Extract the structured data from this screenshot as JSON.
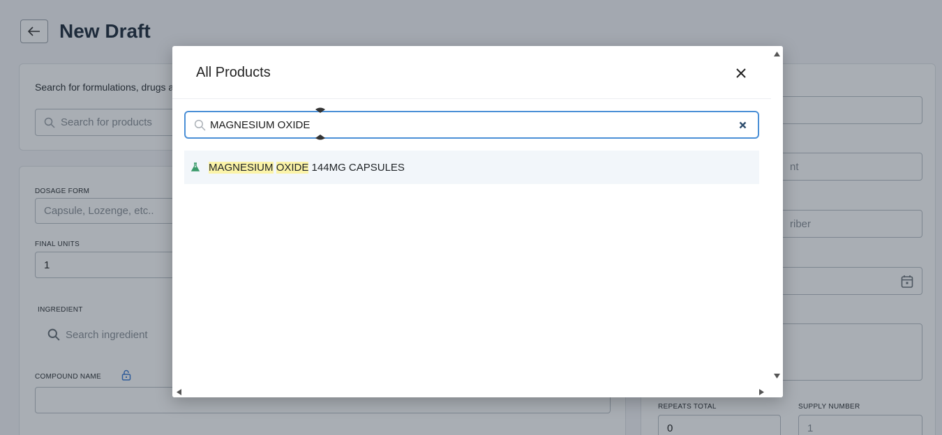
{
  "page": {
    "title": "New Draft",
    "search_card": {
      "label": "Search for formulations, drugs and compounds",
      "search_placeholder": "Search for products"
    },
    "main_card": {
      "dosage_form_label": "DOSAGE FORM",
      "dosage_form_placeholder": "Capsule, Lozenge, etc..",
      "final_units_label": "FINAL UNITS",
      "final_units_value": "1",
      "ingredient_label": "INGREDIENT",
      "ingredient_placeholder": "Search ingredient",
      "compound_name_label": "COMPOUND NAME"
    },
    "right_card": {
      "field_2_fragment": "nt",
      "field_3_fragment": "riber",
      "repeats_total_label": "REPEATS TOTAL",
      "repeats_total_value": "0",
      "supply_number_label": "SUPPLY NUMBER",
      "supply_number_placeholder": "1"
    }
  },
  "modal": {
    "title": "All Products",
    "search_value": "MAGNESIUM OXIDE",
    "results": [
      {
        "highlight_1": "MAGNESIUM",
        "space": " ",
        "highlight_2": "OXIDE",
        "rest": " 144MG CAPSULES",
        "icon": "flask-icon"
      }
    ]
  },
  "colors": {
    "overlay": "#1e2a3a",
    "search_border": "#4a8fd6",
    "result_bg": "#f2f6fa",
    "highlight": "#fbf3a8",
    "flask_icon": "#3a9a6a",
    "clear_icon": "#2f4e6e"
  }
}
